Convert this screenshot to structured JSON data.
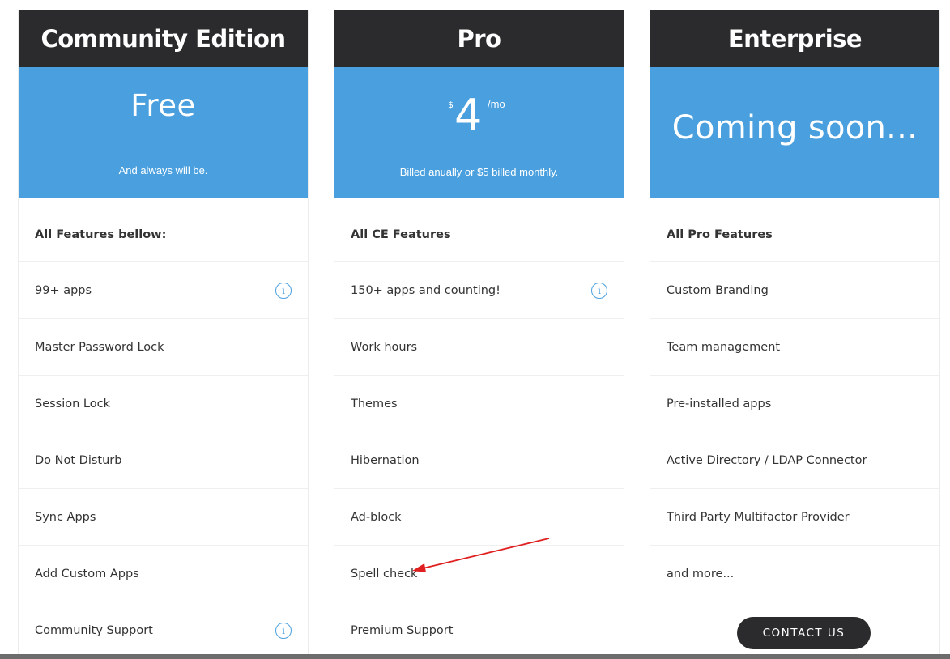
{
  "colors": {
    "header_bg": "#2b2b2d",
    "price_bg": "#4aa0df",
    "info_icon": "#4aa0df",
    "annotation_arrow": "#e02020"
  },
  "plans": [
    {
      "title": "Community Edition",
      "price": "Free",
      "price_note": "And always will be.",
      "features": [
        {
          "label": "All Features bellow:",
          "info": false
        },
        {
          "label": "99+ apps",
          "info": true
        },
        {
          "label": "Master Password Lock",
          "info": false
        },
        {
          "label": "Session Lock",
          "info": false
        },
        {
          "label": "Do Not Disturb",
          "info": false
        },
        {
          "label": "Sync Apps",
          "info": false
        },
        {
          "label": "Add Custom Apps",
          "info": false
        },
        {
          "label": "Community Support",
          "info": true
        }
      ]
    },
    {
      "title": "Pro",
      "price_currency": "$",
      "price_amount": "4",
      "price_period": "/mo",
      "price_note": "Billed anually or $5 billed monthly.",
      "features": [
        {
          "label": "All CE Features",
          "info": false
        },
        {
          "label": "150+ apps and counting!",
          "info": true
        },
        {
          "label": "Work hours",
          "info": false
        },
        {
          "label": "Themes",
          "info": false
        },
        {
          "label": "Hibernation",
          "info": false
        },
        {
          "label": "Ad-block",
          "info": false
        },
        {
          "label": "Spell check",
          "info": false
        },
        {
          "label": "Premium Support",
          "info": false
        }
      ]
    },
    {
      "title": "Enterprise",
      "price": "Coming soon...",
      "features": [
        {
          "label": "All Pro Features",
          "info": false
        },
        {
          "label": "Custom Branding",
          "info": false
        },
        {
          "label": "Team management",
          "info": false
        },
        {
          "label": "Pre-installed apps",
          "info": false
        },
        {
          "label": "Active Directory / LDAP Connector",
          "info": false
        },
        {
          "label": "Third Party Multifactor Provider",
          "info": false
        },
        {
          "label": "and more...",
          "info": false
        }
      ],
      "cta_label": "CONTACT US"
    }
  ],
  "info_glyph": "i"
}
